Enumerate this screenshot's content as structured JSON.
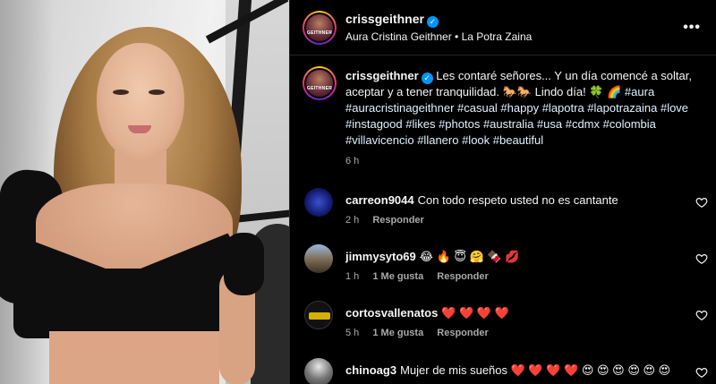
{
  "post": {
    "username": "crissgeithner",
    "verified": true,
    "location": "Aura Cristina Geithner • La Potra Zaina",
    "avatar_label": "GEITHNER"
  },
  "caption": {
    "username": "crissgeithner",
    "text": "Les contaré señores... Y un día comencé a soltar, aceptar y a tener tranquilidad. 🐎🐎 Lindo día! 🍀 🌈",
    "hashtags": "#aura #auracristinageithner #casual #happy #lapotra #lapotrazaina #love #instagood #likes #photos #australia #usa #cdmx #colombia #villavicencio #llanero #look #beautiful",
    "time": "6 h"
  },
  "comments": [
    {
      "username": "carreon9044",
      "text": "Con todo respeto usted no es cantante",
      "time": "2 h",
      "likes": "",
      "reply": "Responder",
      "avatar_color": "#1a2a8a"
    },
    {
      "username": "jimmysyto69",
      "text": "😂 🔥 😇 🤗 🍫 💋",
      "time": "1 h",
      "likes": "1 Me gusta",
      "reply": "Responder",
      "avatar_color": "#7a6a50"
    },
    {
      "username": "cortosvallenatos",
      "text": "❤️ ❤️ ❤️ ❤️",
      "time": "5 h",
      "likes": "1 Me gusta",
      "reply": "Responder",
      "avatar_color": "#222222"
    },
    {
      "username": "chinoag3",
      "text": "Mujer de mis sueños ❤️ ❤️ ❤️ ❤️ 😍 😍 😍 😍 😍 😍",
      "time": "",
      "likes": "",
      "reply": "",
      "avatar_color": "#555555"
    }
  ]
}
